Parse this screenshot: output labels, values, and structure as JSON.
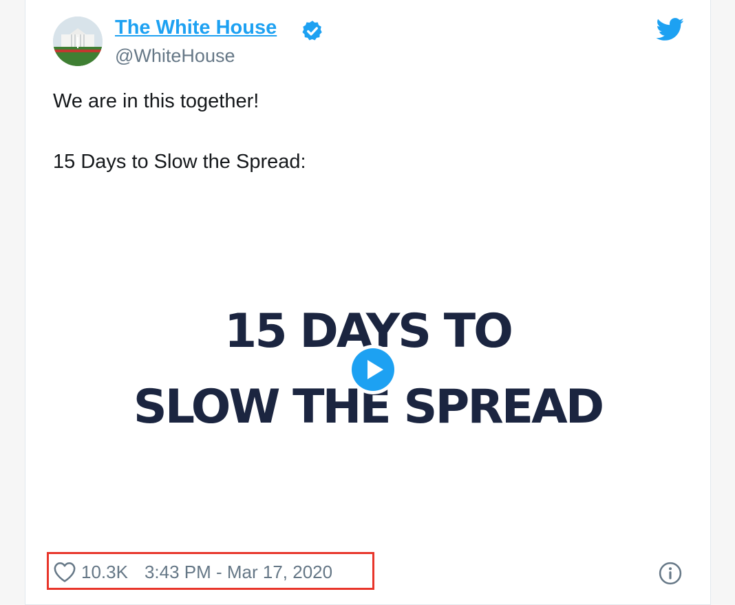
{
  "tweet": {
    "display_name": "The White House",
    "handle": "@WhiteHouse",
    "text_line_1": "We are in this together!",
    "text_line_2": "15 Days to Slow the Spread:",
    "media": {
      "line_1": "15 DAYS TO",
      "line_2": "SLOW THE SPREAD"
    },
    "likes": "10.3K",
    "timestamp": "3:43 PM - Mar 17, 2020"
  },
  "icons": {
    "avatar": "white-house-avatar",
    "verified": "verified-badge-icon",
    "logo": "twitter-bird-icon",
    "play": "play-icon",
    "like": "heart-icon",
    "info": "info-icon"
  },
  "colors": {
    "link": "#1da1f2",
    "brand": "#1da1f2",
    "text": "#14171a",
    "muted": "#657786",
    "media_text": "#1b2540",
    "highlight": "#e8352a"
  }
}
